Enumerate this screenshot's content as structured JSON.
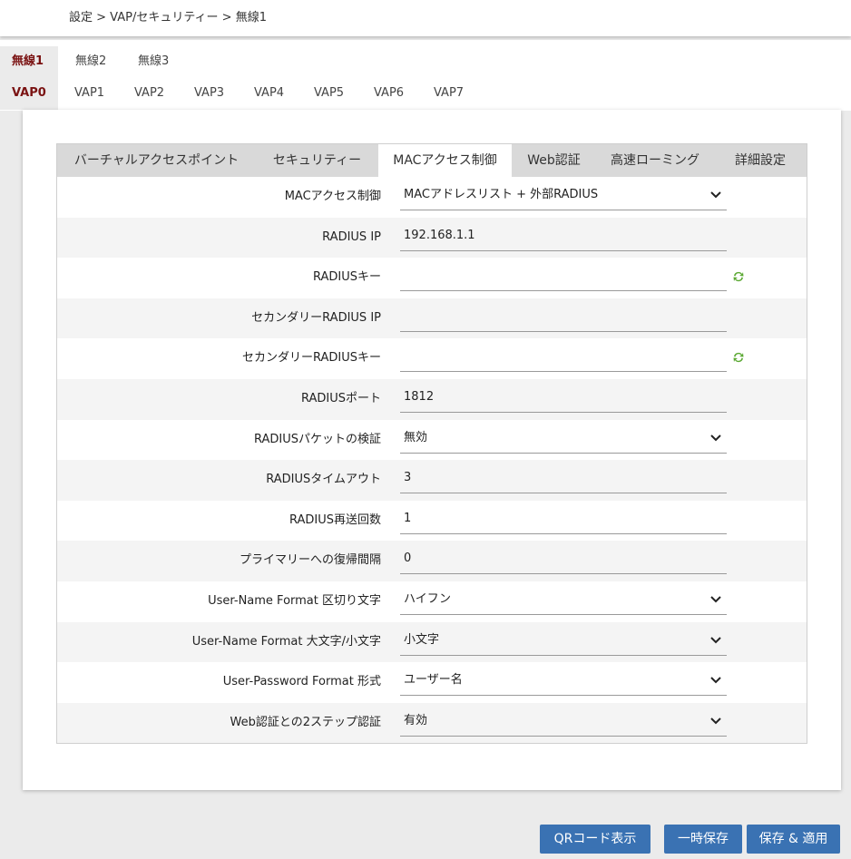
{
  "breadcrumb": "設定 > VAP/セキュリティー > 無線1",
  "radio_tabs": [
    {
      "label": "無線1",
      "active": true
    },
    {
      "label": "無線2",
      "active": false
    },
    {
      "label": "無線3",
      "active": false
    }
  ],
  "vap_tabs": [
    {
      "label": "VAP0",
      "active": true
    },
    {
      "label": "VAP1",
      "active": false
    },
    {
      "label": "VAP2",
      "active": false
    },
    {
      "label": "VAP3",
      "active": false
    },
    {
      "label": "VAP4",
      "active": false
    },
    {
      "label": "VAP5",
      "active": false
    },
    {
      "label": "VAP6",
      "active": false
    },
    {
      "label": "VAP7",
      "active": false
    }
  ],
  "sub_tabs": [
    {
      "label": "バーチャルアクセスポイント",
      "active": false
    },
    {
      "label": "セキュリティー",
      "active": false
    },
    {
      "label": "MACアクセス制御",
      "active": true
    },
    {
      "label": "Web認証",
      "active": false
    },
    {
      "label": "高速ローミング",
      "active": false
    },
    {
      "label": "詳細設定",
      "active": false
    }
  ],
  "form": [
    {
      "label": "MACアクセス制御",
      "type": "select",
      "value": "MACアドレスリスト + 外部RADIUS"
    },
    {
      "label": "RADIUS IP",
      "type": "input",
      "value": "192.168.1.1"
    },
    {
      "label": "RADIUSキー",
      "type": "input",
      "value": "",
      "refresh": true
    },
    {
      "label": "セカンダリーRADIUS IP",
      "type": "input",
      "value": ""
    },
    {
      "label": "セカンダリーRADIUSキー",
      "type": "input",
      "value": "",
      "refresh": true
    },
    {
      "label": "RADIUSポート",
      "type": "input",
      "value": "1812"
    },
    {
      "label": "RADIUSパケットの検証",
      "type": "select",
      "value": "無効"
    },
    {
      "label": "RADIUSタイムアウト",
      "type": "input",
      "value": "3"
    },
    {
      "label": "RADIUS再送回数",
      "type": "input",
      "value": "1"
    },
    {
      "label": "プライマリーへの復帰間隔",
      "type": "input",
      "value": "0"
    },
    {
      "label": "User-Name Format 区切り文字",
      "type": "select",
      "value": "ハイフン"
    },
    {
      "label": "User-Name Format 大文字/小文字",
      "type": "select",
      "value": "小文字"
    },
    {
      "label": "User-Password Format 形式",
      "type": "select",
      "value": "ユーザー名"
    },
    {
      "label": "Web認証との2ステップ認証",
      "type": "select",
      "value": "有効"
    }
  ],
  "buttons": {
    "qr": "QRコード表示",
    "temp_save": "一時保存",
    "save_apply": "保存 & 適用"
  },
  "colors": {
    "accent_text": "#7a1212",
    "button": "#3a72b3",
    "refresh_icon": "#5aa832"
  }
}
